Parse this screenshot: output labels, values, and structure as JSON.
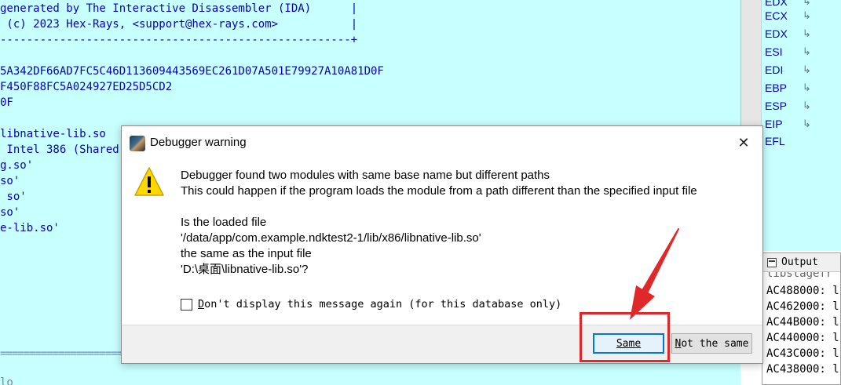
{
  "listing": {
    "lines": [
      "generated by The Interactive Disassembler (IDA)      |",
      " (c) 2023 Hex-Rays, <support@hex-rays.com>           |",
      "-----------------------------------------------------+",
      "",
      "5A342DF66AD7FC5C46D113609443569EC261D07A501E79927A10A81D0F",
      "F450F88FC5A024927ED25D5CD2",
      "0F",
      "",
      "libnative-lib.so",
      " Intel 386 (Shared",
      "g.so'",
      "so'",
      " so'",
      "so'",
      "e-lib.so'"
    ],
    "bottom_separator": "=====================================================",
    "bottom_label": "lo"
  },
  "registers": [
    {
      "name": "EDX",
      "arrow": "↳"
    },
    {
      "name": "ECX",
      "arrow": "↳"
    },
    {
      "name": "EDX",
      "arrow": "↳"
    },
    {
      "name": "ESI",
      "arrow": "↳"
    },
    {
      "name": "EDI",
      "arrow": "↳"
    },
    {
      "name": "EBP",
      "arrow": "↳"
    },
    {
      "name": "ESP",
      "arrow": "↳"
    },
    {
      "name": "EIP",
      "arrow": "↳"
    },
    {
      "name": "EFL",
      "arrow": ""
    }
  ],
  "output": {
    "title": "Output",
    "lines": [
      "libstagefr",
      "AC488000: l",
      "AC462000: l",
      "AC44B000: l",
      "AC440000: l",
      "AC43C000: l",
      "AC438000: l"
    ]
  },
  "dialog": {
    "title": "Debugger warning",
    "close_glyph": "✕",
    "message_line1": "Debugger found two modules with same base name but different paths",
    "message_line2": "This could happen if the program loads the module from a path different than the specified input file",
    "question_line1": "Is the loaded file",
    "question_line2": "'/data/app/com.example.ndktest2-1/lib/x86/libnative-lib.so'",
    "question_line3": "the same as the input file",
    "question_line4": "'D:\\桌面\\libnative-lib.so'?",
    "checkbox_label": "Don't display this message again (for this database only)",
    "checkbox_checked": false,
    "buttons": {
      "same": "Same",
      "not_same": "Not the same"
    }
  },
  "colors": {
    "listing_bg": "#c8ffff",
    "listing_text": "#0000c0",
    "annotation_red": "#e0282a",
    "warning_yellow": "#ffd800"
  },
  "icons": {
    "dialog_icon": "ida-app-icon",
    "warning": "warning-triangle-icon",
    "register_arrow": "jump-arrow-icon"
  }
}
